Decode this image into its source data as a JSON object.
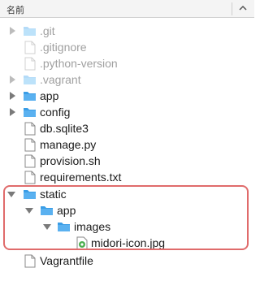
{
  "header": {
    "column_label": "名前",
    "sort_indicator": "chevron-up-icon"
  },
  "colors": {
    "folder": "#5ab1f0",
    "highlight": "#e06b6b",
    "dim_text": "#a0a0a0"
  },
  "items": [
    {
      "label": ".git",
      "kind": "folder",
      "expanded": false,
      "dim": true
    },
    {
      "label": ".gitignore",
      "kind": "file",
      "dim": true
    },
    {
      "label": ".python-version",
      "kind": "file",
      "dim": true
    },
    {
      "label": ".vagrant",
      "kind": "folder",
      "expanded": false,
      "dim": true
    },
    {
      "label": "app",
      "kind": "folder",
      "expanded": false,
      "dim": false
    },
    {
      "label": "config",
      "kind": "folder",
      "expanded": false,
      "dim": false
    },
    {
      "label": "db.sqlite3",
      "kind": "file",
      "dim": false
    },
    {
      "label": "manage.py",
      "kind": "file",
      "dim": false
    },
    {
      "label": "provision.sh",
      "kind": "file",
      "dim": false
    },
    {
      "label": "requirements.txt",
      "kind": "file",
      "dim": false
    },
    {
      "label": "static",
      "kind": "folder",
      "expanded": true,
      "dim": false
    },
    {
      "label": "app",
      "kind": "folder",
      "expanded": true,
      "dim": false
    },
    {
      "label": "images",
      "kind": "folder",
      "expanded": true,
      "dim": false
    },
    {
      "label": "midori-icon.jpg",
      "kind": "image",
      "dim": false
    },
    {
      "label": "Vagrantfile",
      "kind": "file",
      "dim": false
    }
  ]
}
